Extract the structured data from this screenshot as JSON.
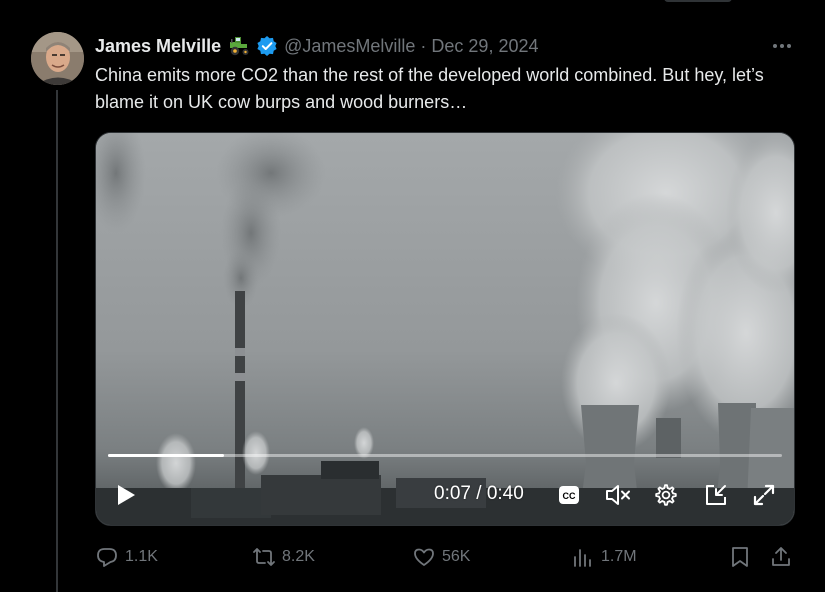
{
  "tweet": {
    "author_name": "James Melville",
    "handle": "@JamesMelville",
    "separator": "·",
    "date": "Dec 29, 2024",
    "text": "China emits more CO2 than the rest of the developed world combined. But hey, let’s blame it on UK cow burps and wood burners…"
  },
  "video": {
    "time_display": "0:07 / 0:40",
    "progress": 0.172,
    "cc_label": "CC"
  },
  "actions": {
    "replies": "1.1K",
    "reposts": "8.2K",
    "likes": "56K",
    "views": "1.7M"
  },
  "colors": {
    "background": "#000000",
    "text": "#e7e9ea",
    "muted": "#71767b",
    "verified": "#1d9bf0"
  },
  "icons": [
    "tractor-icon",
    "verified-badge-icon",
    "more-icon",
    "play-icon",
    "captions-icon",
    "mute-icon",
    "settings-icon",
    "pip-icon",
    "fullscreen-icon",
    "reply-icon",
    "repost-icon",
    "like-icon",
    "views-icon",
    "bookmark-icon",
    "share-icon"
  ]
}
